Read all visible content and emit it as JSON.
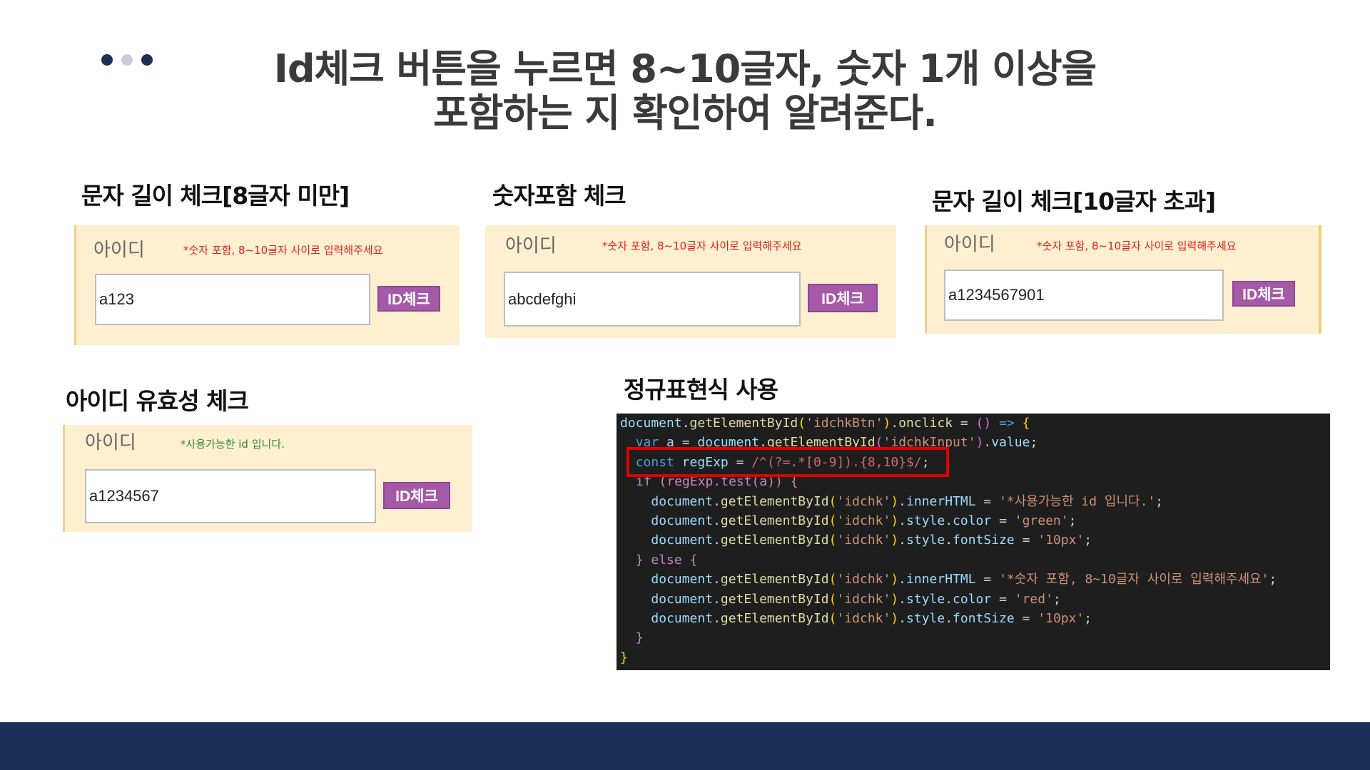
{
  "title": {
    "line1": "Id체크 버튼을 누르면 8~10글자, 숫자 1개 이상을",
    "line2": "포함하는 지 확인하여 알려준다."
  },
  "dots_colors": [
    "#1c2f57",
    "#c9cdd6",
    "#1c2f57"
  ],
  "panels": [
    {
      "heading": "문자 길이 체크[8글자 미만]",
      "label": "아이디",
      "hint": "*숫자 포함, 8~10글자 사이로 입력해주세요",
      "hint_color": "#e02020",
      "value": "a123",
      "button": "ID체크"
    },
    {
      "heading": "숫자포함 체크",
      "label": "아이디",
      "hint": "*숫자 포함, 8~10글자 사이로 입력해주세요",
      "hint_color": "#e02020",
      "value": "abcdefghi",
      "button": "ID체크"
    },
    {
      "heading": "문자 길이 체크[10글자 초과]",
      "label": "아이디",
      "hint": "*숫자 포함, 8~10글자 사이로 입력해주세요",
      "hint_color": "#e02020",
      "value": "a1234567901",
      "button": "ID체크"
    },
    {
      "heading": "아이디 유효성 체크",
      "label": "아이디",
      "hint": "*사용가능한 id 입니다.",
      "hint_color": "#2e8b2e",
      "value": "a1234567",
      "button": "ID체크"
    }
  ],
  "code_section": {
    "heading": "정규표현식 사용",
    "highlight_color": "#e00000",
    "lines": {
      "l1_doc": "document",
      "l1_fn": "getElementById",
      "l1_str": "'idchkBtn'",
      "l1_prop": "onclick",
      "l2_kw": "var",
      "l2_var": "a",
      "l2_doc": "document",
      "l2_fn": "getElementById",
      "l2_str": "'idchkInput'",
      "l2_prop": "value",
      "l3_kw": "const",
      "l3_var": "regExp",
      "l3_regex": "/^(?=.*[0-9]).{8,10}$/",
      "l4": "if (regExp.test(a)) {",
      "l5_str": "'*사용가능한 id 입니다.'",
      "l6_str": "'green'",
      "l7_str": "'10px'",
      "l8_kw": "else",
      "l9_str": "'*숫자 포함, 8~10글자 사이로 입력해주세요'",
      "l10_str": "'red'",
      "l11_str": "'10px'",
      "idchk": "'idchk'",
      "doc": "document",
      "fn": "getElementById",
      "innerHTML": "innerHTML",
      "style": "style",
      "color": "color",
      "fontSize": "fontSize"
    }
  },
  "footer_color": "#1c2f57"
}
